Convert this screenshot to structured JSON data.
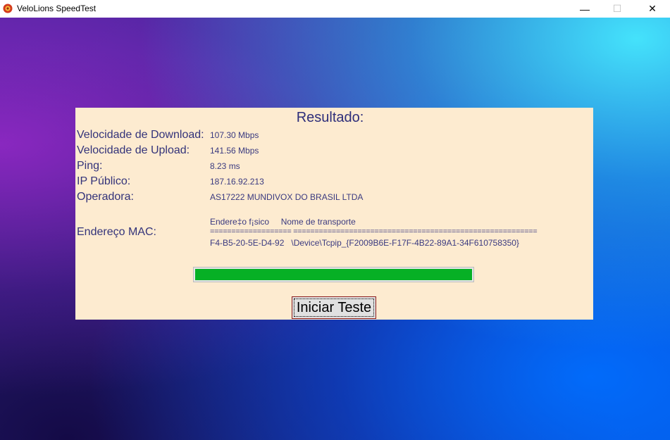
{
  "window": {
    "title": "VeloLions SpeedTest",
    "minimize_glyph": "—",
    "maximize_glyph": "☐",
    "close_glyph": "✕",
    "icon": "velolions-logo-icon"
  },
  "result": {
    "heading": "Resultado:",
    "rows": [
      {
        "label": "Velocidade de Download:",
        "value": "107.30 Mbps"
      },
      {
        "label": "Velocidade de Upload:",
        "value": "141.56 Mbps"
      },
      {
        "label": "Ping:",
        "value": "8.23 ms"
      },
      {
        "label": "IP Público:",
        "value": "187.16.92.213"
      },
      {
        "label": "Operadora:",
        "value": "AS17222 MUNDIVOX DO BRASIL LTDA"
      }
    ],
    "mac": {
      "label": "Endereço MAC:",
      "header": "Endere‡o f¡sico     Nome de transporte",
      "separator": "=================== =========================================================",
      "entry": "F4-B5-20-5E-D4-92   \\Device\\Tcpip_{F2009B6E-F17F-4B22-89A1-34F610758350}"
    }
  },
  "progress": {
    "fraction": 1.0,
    "color": "#06b025"
  },
  "start_button": {
    "label": "Iniciar Teste"
  }
}
